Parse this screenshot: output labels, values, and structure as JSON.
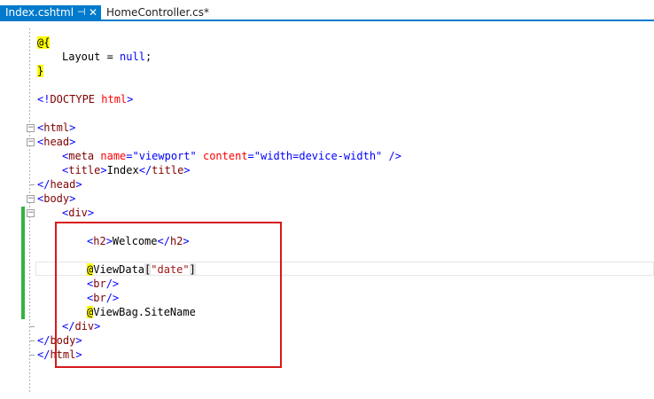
{
  "tabs": [
    {
      "label": "Index.cshtml",
      "active": true,
      "pin_icon": "pin-icon",
      "close_icon": "close-icon"
    },
    {
      "label": "HomeController.cs*",
      "active": false
    }
  ],
  "code": {
    "l1": {
      "raz": "@{"
    },
    "l2": {
      "ident": "Layout",
      "op": " = ",
      "kw": "null",
      "end": ";"
    },
    "l3": {
      "raz": "}"
    },
    "l4": {
      "open": "<!",
      "name": "DOCTYPE",
      "attr": " html",
      "close": ">"
    },
    "l5": {
      "open": "<",
      "name": "html",
      "close": ">"
    },
    "l6": {
      "open": "<",
      "name": "head",
      "close": ">"
    },
    "l7": {
      "open": "<",
      "name": "meta",
      "a1": " name",
      "eq1": "=",
      "v1": "\"viewport\"",
      "a2": " content",
      "eq2": "=",
      "v2": "\"width=device-width\"",
      "close": " />"
    },
    "l8": {
      "open": "<",
      "name": "title",
      "close": ">",
      "text": "Index",
      "open2": "</",
      "name2": "title",
      "close2": ">"
    },
    "l9": {
      "open": "</",
      "name": "head",
      "close": ">"
    },
    "l10": {
      "open": "<",
      "name": "body",
      "close": ">"
    },
    "l11": {
      "open": "<",
      "name": "div",
      "close": ">"
    },
    "l12": {
      "open": "<",
      "name": "h2",
      "close": ">",
      "text": "Welcome",
      "open2": "</",
      "name2": "h2",
      "close2": ">"
    },
    "l13": {
      "raz": "@",
      "ident": "ViewData",
      "br1": "[",
      "str": "\"date\"",
      "br2": "]"
    },
    "l14": {
      "open": "<",
      "name": "br",
      "close": "/>"
    },
    "l15": {
      "open": "<",
      "name": "br",
      "close": "/>"
    },
    "l16": {
      "raz": "@",
      "ident": "ViewBag.SiteName"
    },
    "l17": {
      "open": "</",
      "name": "div",
      "close": ">"
    },
    "l18": {
      "open": "</",
      "name": "body",
      "close": ">"
    },
    "l19": {
      "open": "</",
      "name": "html",
      "close": ">"
    }
  },
  "colors": {
    "accent": "#007acc",
    "change_marker": "#34b340",
    "annotation_box": "#d7191c",
    "razor_highlight": "#ffff00"
  }
}
